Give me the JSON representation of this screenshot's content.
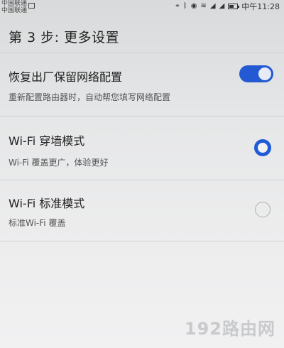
{
  "status_bar": {
    "carrier_1": "中国联通",
    "carrier_2": "中国联通",
    "time": "中午11:28",
    "icons": [
      "location-icon",
      "bluetooth-icon",
      "eye-icon",
      "wifi-icon",
      "signal-icon",
      "signal-icon",
      "battery-icon"
    ],
    "battery_level": 0.6
  },
  "page": {
    "title": "第 3 步: 更多设置"
  },
  "settings": {
    "restore": {
      "title": "恢复出厂保留网络配置",
      "subtitle": "重新配置路由器时，自动帮您填写网络配置",
      "enabled": true
    },
    "wall_mode": {
      "title": "Wi-Fi 穿墙模式",
      "subtitle": "Wi-Fi 覆盖更广，体验更好",
      "selected": true
    },
    "standard_mode": {
      "title": "Wi-Fi 标准模式",
      "subtitle": "标准Wi-Fi 覆盖",
      "selected": false
    }
  },
  "watermark": "192路由网",
  "colors": {
    "accent": "#2359d3",
    "background": "#e6e7e8"
  }
}
